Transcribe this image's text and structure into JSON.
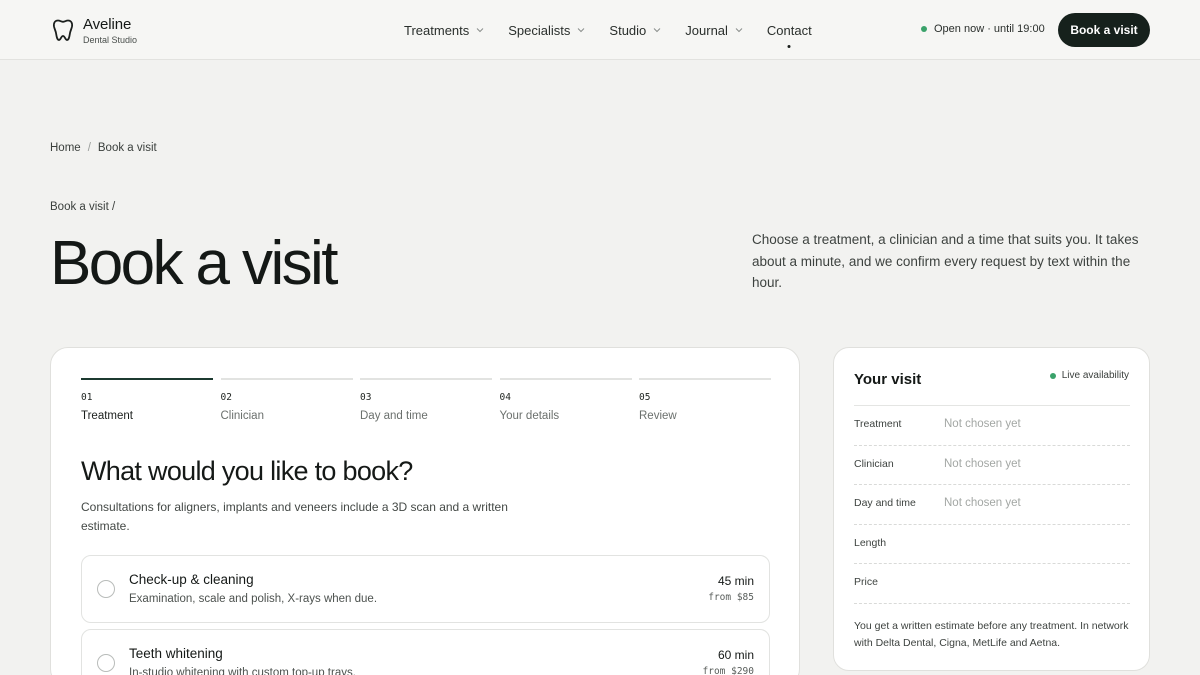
{
  "brand": {
    "name": "Aveline",
    "subtitle": "Dental Studio",
    "icon": "tooth-icon"
  },
  "nav": {
    "items": [
      {
        "label": "Treatments",
        "has_dropdown": true
      },
      {
        "label": "Specialists",
        "has_dropdown": true
      },
      {
        "label": "Studio",
        "has_dropdown": true
      },
      {
        "label": "Journal",
        "has_dropdown": true
      },
      {
        "label": "Contact",
        "has_dropdown": false,
        "active": true
      }
    ]
  },
  "header": {
    "status": "Open now · until 19:00",
    "status_color": "#3aa26a",
    "cta": "Book a visit"
  },
  "breadcrumb": {
    "home": "Home",
    "separator": "/",
    "current": "Book a visit"
  },
  "hero": {
    "eyebrow": "Book a visit /",
    "title": "Book a visit",
    "description": "Choose a treatment, a clinician and a time that suits you. It takes about a minute, and we confirm every request by text within the hour."
  },
  "steps": [
    {
      "number": "01",
      "label": "Treatment",
      "active": true
    },
    {
      "number": "02",
      "label": "Clinician",
      "active": false
    },
    {
      "number": "03",
      "label": "Day and time",
      "active": false
    },
    {
      "number": "04",
      "label": "Your details",
      "active": false
    },
    {
      "number": "05",
      "label": "Review",
      "active": false
    }
  ],
  "booking": {
    "title": "What would you like to book?",
    "description": "Consultations for aligners, implants and veneers include a 3D scan and a written estimate.",
    "options": [
      {
        "name": "Check-up & cleaning",
        "description": "Examination, scale and polish, X-rays when due.",
        "duration": "45 min",
        "price": "from $85"
      },
      {
        "name": "Teeth whitening",
        "description": "In-studio whitening with custom top-up trays.",
        "duration": "60 min",
        "price": "from $290"
      }
    ]
  },
  "summary": {
    "title": "Your visit",
    "live_label": "Live availability",
    "rows": [
      {
        "label": "Treatment",
        "value": "Not chosen yet"
      },
      {
        "label": "Clinician",
        "value": "Not chosen yet"
      },
      {
        "label": "Day and time",
        "value": "Not chosen yet"
      },
      {
        "label": "Length",
        "value": ""
      },
      {
        "label": "Price",
        "value": ""
      }
    ],
    "note": "You get a written estimate before any treatment. In network with Delta Dental, Cigna, MetLife and Aetna."
  },
  "colors": {
    "accent": "#16211c",
    "progress": "#1c3a30",
    "live": "#3aa26a",
    "background": "#f2f2f0"
  }
}
